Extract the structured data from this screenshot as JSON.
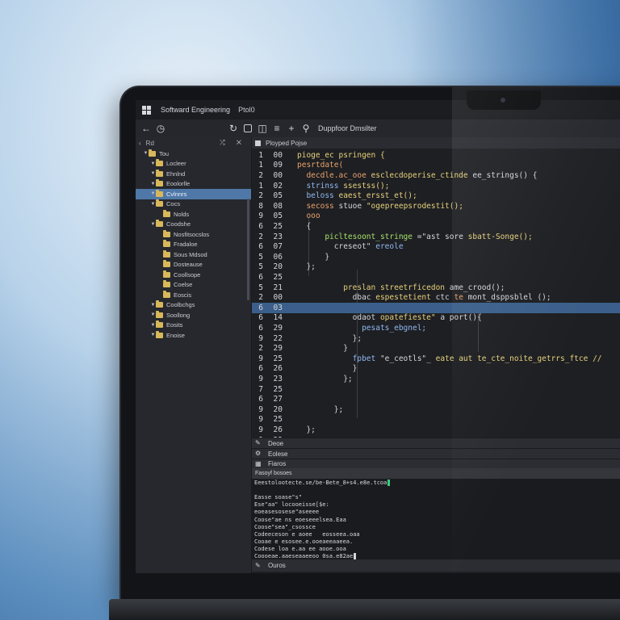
{
  "colors": {
    "selection": "#4f78a8",
    "highlight_line": "#3b5f8a",
    "cursor_green": "#33d17a",
    "syn_yellow": "#e6d17a",
    "syn_blue": "#8fb8f0",
    "syn_green": "#a6e26b",
    "syn_orange": "#e8a36a",
    "syn_purple": "#c8a6f0",
    "syn_default": "#d4d6db"
  },
  "window": {
    "title": "Softward Engineering",
    "subtitle": "Ptol0"
  },
  "toolbar": {
    "back_icon": "back-arrow-icon",
    "history_icon": "clock-icon",
    "explorer_label": "Duppfoor Dmsilter"
  },
  "sidebar": {
    "header_label": "Rd",
    "header_actions": "⤮ ✕",
    "items": [
      {
        "label": "Tou",
        "indent": 1,
        "expanded": true
      },
      {
        "label": "Locleer",
        "indent": 2,
        "expanded": true
      },
      {
        "label": "Ehnlnd",
        "indent": 2,
        "expanded": true
      },
      {
        "label": "Eoolorlle",
        "indent": 2,
        "expanded": true
      },
      {
        "label": "Cvlnnrs",
        "indent": 2,
        "expanded": true,
        "selected": true
      },
      {
        "label": "Cocs",
        "indent": 2,
        "expanded": true
      },
      {
        "label": "Nolds",
        "indent": 3,
        "expanded": false
      },
      {
        "label": "Coodshe",
        "indent": 2,
        "expanded": true
      },
      {
        "label": "Nosfitsocslos",
        "indent": 3,
        "expanded": false
      },
      {
        "label": "Fradaloe",
        "indent": 3,
        "expanded": false
      },
      {
        "label": "Sous Mdsod",
        "indent": 3,
        "expanded": false
      },
      {
        "label": "Dosteause",
        "indent": 3,
        "expanded": false
      },
      {
        "label": "Coollsope",
        "indent": 3,
        "expanded": false
      },
      {
        "label": "Coelse",
        "indent": 3,
        "expanded": false
      },
      {
        "label": "Eoscis",
        "indent": 3,
        "expanded": false
      },
      {
        "label": "Coolbchgs",
        "indent": 2,
        "expanded": true
      },
      {
        "label": "Soollong",
        "indent": 2,
        "expanded": true
      },
      {
        "label": "Eosits",
        "indent": 2,
        "expanded": true
      },
      {
        "label": "Enoise",
        "indent": 2,
        "expanded": true
      }
    ]
  },
  "editor": {
    "tab_label": "Ployped Pojse",
    "lines": [
      {
        "n1": "1",
        "n2": "00",
        "segs": [
          {
            "t": "pioge_ec psringen {",
            "c": "syn_yellow"
          }
        ]
      },
      {
        "n1": "1",
        "n2": "09",
        "segs": [
          {
            "t": "pesrtdate(",
            "c": "syn_orange"
          }
        ]
      },
      {
        "n1": "2",
        "n2": "00",
        "segs": [
          {
            "t": "  decdle.ac_ooe ",
            "c": "syn_orange"
          },
          {
            "t": "esclecdoperise_ctinde ",
            "c": "syn_yellow"
          },
          {
            "t": "ee_strings() {",
            "c": "syn_default"
          }
        ]
      },
      {
        "n1": "1",
        "n2": "02",
        "segs": [
          {
            "t": "  strinss ",
            "c": "syn_blue"
          },
          {
            "t": "ssestss();",
            "c": "syn_yellow"
          }
        ]
      },
      {
        "n1": "2",
        "n2": "05",
        "segs": [
          {
            "t": "  beloss ",
            "c": "syn_blue"
          },
          {
            "t": "eaest_ersst_et();",
            "c": "syn_yellow"
          }
        ]
      },
      {
        "n1": "8",
        "n2": "08",
        "segs": [
          {
            "t": "  secoss ",
            "c": "syn_orange"
          },
          {
            "t": "stuoe ",
            "c": "syn_default"
          },
          {
            "t": "\"ogepreepsrodestit();",
            "c": "syn_yellow"
          }
        ]
      },
      {
        "n1": "9",
        "n2": "05",
        "segs": [
          {
            "t": "  ooo",
            "c": "syn_orange"
          }
        ]
      },
      {
        "n1": "6",
        "n2": "25",
        "segs": [
          {
            "t": "  {",
            "c": "syn_default"
          }
        ]
      },
      {
        "n1": "2",
        "n2": "23",
        "segs": [
          {
            "t": "      picltesoont_stringe ",
            "c": "syn_green"
          },
          {
            "t": "=\"ast sore ",
            "c": "syn_default"
          },
          {
            "t": "sbatt-Songe();",
            "c": "syn_yellow"
          }
        ]
      },
      {
        "n1": "6",
        "n2": "07",
        "segs": [
          {
            "t": "        creseot\" ",
            "c": "syn_default"
          },
          {
            "t": "ereole",
            "c": "syn_blue"
          }
        ]
      },
      {
        "n1": "5",
        "n2": "06",
        "segs": [
          {
            "t": "      }",
            "c": "syn_default"
          }
        ]
      },
      {
        "n1": "5",
        "n2": "20",
        "segs": [
          {
            "t": "  };",
            "c": "syn_default"
          }
        ]
      },
      {
        "n1": "6",
        "n2": "25",
        "segs": [
          {
            "t": "",
            "c": "syn_default"
          }
        ]
      },
      {
        "n1": "5",
        "n2": "21",
        "segs": [
          {
            "t": "          preslan ",
            "c": "syn_yellow"
          },
          {
            "t": "streetrficedon ",
            "c": "syn_yellow"
          },
          {
            "t": "ame_crood();",
            "c": "syn_default"
          }
        ]
      },
      {
        "n1": "2",
        "n2": "00",
        "segs": [
          {
            "t": "            dbac ",
            "c": "syn_default"
          },
          {
            "t": "espestetient ",
            "c": "syn_yellow"
          },
          {
            "t": "ctc ",
            "c": "syn_default"
          },
          {
            "t": "te ",
            "c": "syn_orange"
          },
          {
            "t": "mont_dsppsblel ();",
            "c": "syn_default"
          }
        ]
      },
      {
        "n1": "6",
        "n2": "03",
        "segs": [
          {
            "t": "",
            "c": "syn_default"
          }
        ],
        "hl": true
      },
      {
        "n1": "6",
        "n2": "14",
        "segs": [
          {
            "t": "            odaot ",
            "c": "syn_default"
          },
          {
            "t": "opatefieste\" ",
            "c": "syn_yellow"
          },
          {
            "t": "a port(){",
            "c": "syn_default"
          }
        ]
      },
      {
        "n1": "6",
        "n2": "29",
        "segs": [
          {
            "t": "              pesats_ebgnel;",
            "c": "syn_blue"
          }
        ]
      },
      {
        "n1": "9",
        "n2": "22",
        "segs": [
          {
            "t": "            };",
            "c": "syn_default"
          }
        ]
      },
      {
        "n1": "2",
        "n2": "29",
        "segs": [
          {
            "t": "          }",
            "c": "syn_default"
          }
        ]
      },
      {
        "n1": "9",
        "n2": "25",
        "segs": [
          {
            "t": "            fpbet ",
            "c": "syn_blue"
          },
          {
            "t": "\"e_ceotls\"_ ",
            "c": "syn_default"
          },
          {
            "t": "eate aut ",
            "c": "syn_yellow"
          },
          {
            "t": "te_cte_noite_getrrs_ftce //",
            "c": "syn_yellow"
          }
        ]
      },
      {
        "n1": "6",
        "n2": "26",
        "segs": [
          {
            "t": "            }",
            "c": "syn_default"
          }
        ]
      },
      {
        "n1": "9",
        "n2": "23",
        "segs": [
          {
            "t": "          };",
            "c": "syn_default"
          }
        ]
      },
      {
        "n1": "7",
        "n2": "25",
        "segs": [
          {
            "t": "",
            "c": "syn_default"
          }
        ]
      },
      {
        "n1": "6",
        "n2": "27",
        "segs": [
          {
            "t": "",
            "c": "syn_default"
          }
        ]
      },
      {
        "n1": "9",
        "n2": "20",
        "segs": [
          {
            "t": "        };",
            "c": "syn_default"
          }
        ]
      },
      {
        "n1": "9",
        "n2": "25",
        "segs": [
          {
            "t": "",
            "c": "syn_default"
          }
        ]
      },
      {
        "n1": "9",
        "n2": "26",
        "segs": [
          {
            "t": "  };",
            "c": "syn_default"
          }
        ]
      },
      {
        "n1": "9",
        "n2": "23",
        "segs": [
          {
            "t": "",
            "c": "syn_default"
          }
        ]
      }
    ]
  },
  "panels": {
    "debug_label": "Deoe",
    "console_label": "Eolese",
    "terminal_tab": "Fiaros",
    "terminal_header": "Fasoyf bosoes"
  },
  "terminal": {
    "lines": [
      {
        "t": "Eeestolootecte.se/be-Bete_8+s4.e8e.tcoa",
        "cursor": true,
        "cursor_color": "cursor_green"
      },
      {
        "t": "",
        "cursor": false
      },
      {
        "t": "Easse soase\"s\"",
        "cursor": false
      },
      {
        "t": "Ese\"aa\" locooeisse[$e:",
        "cursor": false
      },
      {
        "t": "eoeasesosese\"aseeee",
        "cursor": false
      },
      {
        "t": "Coose\"ae ns eoeseeelsea.Eaa",
        "cursor": false
      },
      {
        "t": "Coose\"sea\"_csossce",
        "cursor": false
      },
      {
        "t": "Codeeceson e aoee   eosseea.oaa",
        "cursor": false
      },
      {
        "t": "Cooae e esosee.e.ooeaeeaaeea.",
        "cursor": false
      },
      {
        "t": "Codese loa e.aa ee aooe.ooa",
        "cursor": false
      },
      {
        "t": "Coooeae.aaeseaaeeoo 0sa.e82ae",
        "cursor": true,
        "cursor_color": "syn_default"
      }
    ]
  },
  "status": {
    "bottom_label": "Ouros"
  }
}
